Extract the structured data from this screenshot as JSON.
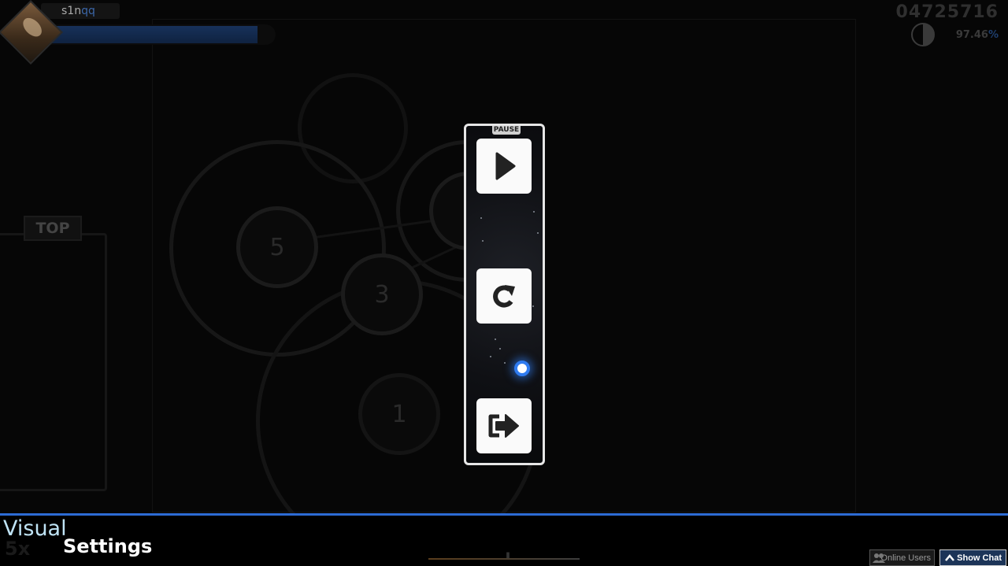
{
  "hud": {
    "username": "s1n",
    "username_accent": "qq",
    "score": "04725716",
    "accuracy_value": "97.46",
    "accuracy_symbol": "%",
    "health_fraction": 0.92,
    "leaderboard_label": "TOP"
  },
  "playfield": {
    "hit_circles": [
      {
        "number": "5"
      },
      {
        "number": "3"
      },
      {
        "number": "1"
      }
    ]
  },
  "pause_menu": {
    "title": "PAUSE",
    "buttons": [
      {
        "name": "continue",
        "icon": "play-icon"
      },
      {
        "name": "retry",
        "icon": "retry-icon"
      },
      {
        "name": "quit",
        "icon": "exit-icon"
      }
    ]
  },
  "bottom": {
    "combo": "5x",
    "visual_label": "Visual",
    "settings_label": "Settings",
    "online_users": "Online Users",
    "show_chat": "Show Chat"
  },
  "colors": {
    "accent_blue": "#2d6bd4",
    "panel_border": "#e6e6e6",
    "visual_text": "#bfe3f5"
  }
}
